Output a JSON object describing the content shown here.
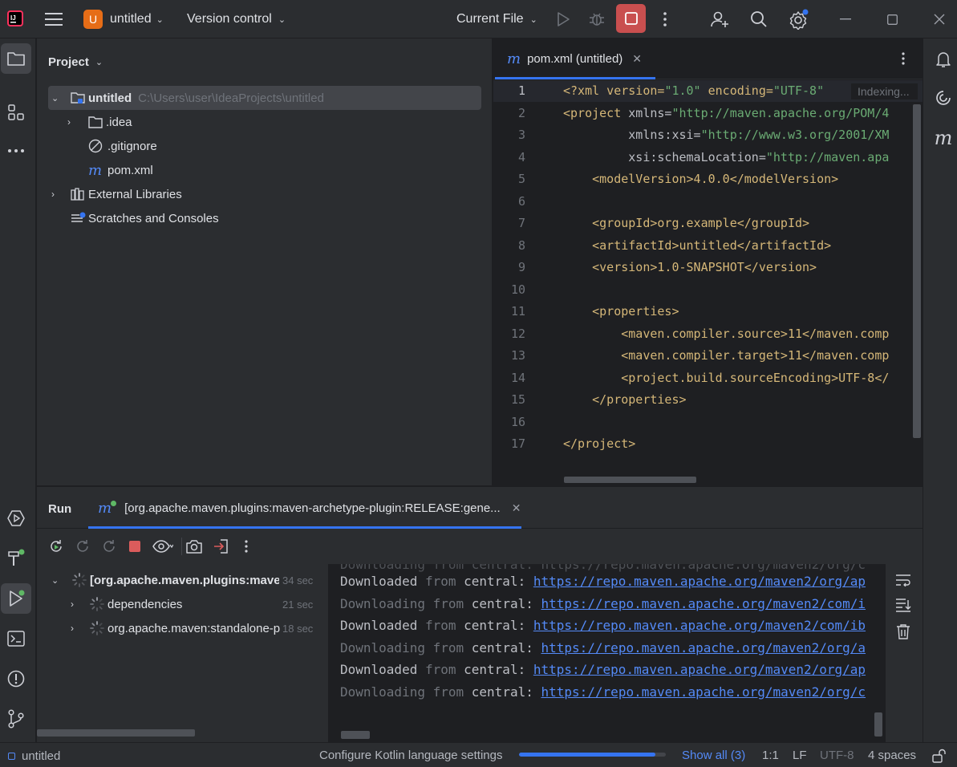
{
  "titlebar": {
    "project_badge": "U",
    "project_name": "untitled",
    "vcs": "Version control",
    "run_config": "Current File"
  },
  "project_panel": {
    "title": "Project",
    "tree": [
      {
        "label": "untitled",
        "path": "C:\\Users\\user\\IdeaProjects\\untitled"
      },
      {
        "label": ".idea"
      },
      {
        "label": ".gitignore"
      },
      {
        "label": "pom.xml"
      },
      {
        "label": "External Libraries"
      },
      {
        "label": "Scratches and Consoles"
      }
    ]
  },
  "editor": {
    "tab_label": "pom.xml (untitled)",
    "indexing": "Indexing...",
    "line_numbers": [
      "1",
      "2",
      "3",
      "4",
      "5",
      "6",
      "7",
      "8",
      "9",
      "10",
      "11",
      "12",
      "13",
      "14",
      "15",
      "16",
      "17"
    ],
    "lines": {
      "l1a": "<?xml version=",
      "l1b": "\"1.0\"",
      "l1c": " encoding=",
      "l1d": "\"UTF-8\"",
      "l2a": "<project",
      "l2b": " xmlns=",
      "l2c": "\"http://maven.apache.org/POM/4",
      "l3a": "         xmlns:xsi=",
      "l3b": "\"http://www.w3.org/2001/XM",
      "l4a": "         xsi:schemaLocation=",
      "l4b": "\"http://maven.apa",
      "l5": "    <modelVersion>4.0.0</modelVersion>",
      "l7": "    <groupId>org.example</groupId>",
      "l8": "    <artifactId>untitled</artifactId>",
      "l9": "    <version>1.0-SNAPSHOT</version>",
      "l11": "    <properties>",
      "l12": "        <maven.compiler.source>11</maven.comp",
      "l13": "        <maven.compiler.target>11</maven.comp",
      "l14": "        <project.build.sourceEncoding>UTF-8</",
      "l15": "    </properties>",
      "l17": "</project>"
    }
  },
  "run_panel": {
    "title": "Run",
    "tab_label": "[org.apache.maven.plugins:maven-archetype-plugin:RELEASE:gene...",
    "tree": [
      {
        "label": "[org.apache.maven.plugins:maven",
        "time": "34 sec"
      },
      {
        "label": "dependencies",
        "time": "21 sec"
      },
      {
        "label": "org.apache.maven:standalone-p",
        "time": "18 sec"
      }
    ],
    "log": [
      {
        "verb": "Downloaded",
        "from": "from",
        "src": "central:",
        "url": "https://repo.maven.apache.org/maven2/org/ap"
      },
      {
        "verb": "Downloading",
        "from": "from",
        "src": "central:",
        "url": "https://repo.maven.apache.org/maven2/com/i"
      },
      {
        "verb": "Downloaded",
        "from": "from",
        "src": "central:",
        "url": "https://repo.maven.apache.org/maven2/com/ib"
      },
      {
        "verb": "Downloading",
        "from": "from",
        "src": "central:",
        "url": "https://repo.maven.apache.org/maven2/org/a"
      },
      {
        "verb": "Downloaded",
        "from": "from",
        "src": "central:",
        "url": "https://repo.maven.apache.org/maven2/org/ap"
      },
      {
        "verb": "Downloading",
        "from": "from",
        "src": "central:",
        "url": "https://repo.maven.apache.org/maven2/org/c"
      }
    ]
  },
  "statusbar": {
    "project": "untitled",
    "task": "Configure Kotlin language settings",
    "progress": 0.93,
    "show_all": "Show all (3)",
    "position": "1:1",
    "line_sep": "LF",
    "encoding": "UTF-8",
    "indent": "4 spaces"
  },
  "colors": {
    "accent": "#3574f0",
    "stop": "#db5c5c",
    "project_badge": "#e66d17",
    "xml_tag": "#d5b778",
    "xml_string": "#6aab73",
    "link": "#548af7"
  }
}
